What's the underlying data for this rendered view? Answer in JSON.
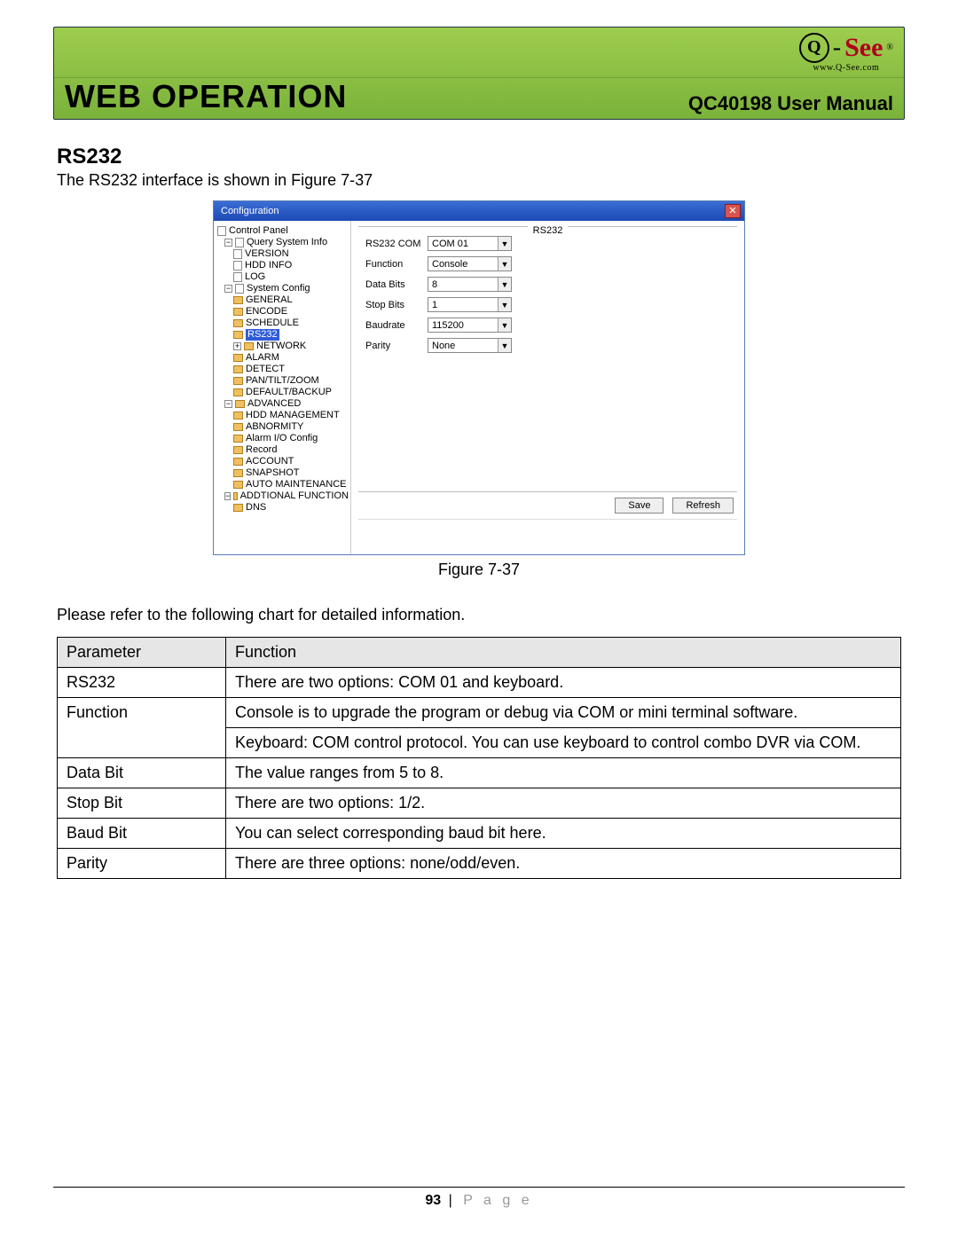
{
  "header": {
    "web_op": "WEB OPERATION",
    "manual": "QC40198 User Manual",
    "logo_text": "See",
    "logo_url": "www.Q-See.com"
  },
  "section": {
    "title": "RS232",
    "lead": "The RS232 interface is shown in Figure 7-37"
  },
  "window": {
    "title": "Configuration",
    "fieldset": "RS232",
    "save": "Save",
    "refresh": "Refresh",
    "form": {
      "com_label": "RS232 COM",
      "com_value": "COM 01",
      "func_label": "Function",
      "func_value": "Console",
      "data_label": "Data Bits",
      "data_value": "8",
      "stop_label": "Stop Bits",
      "stop_value": "1",
      "baud_label": "Baudrate",
      "baud_value": "115200",
      "parity_label": "Parity",
      "parity_value": "None"
    },
    "tree": {
      "root": "Control Panel",
      "g1": "Query System Info",
      "g1a": "VERSION",
      "g1b": "HDD INFO",
      "g1c": "LOG",
      "g2": "System Config",
      "g2a": "GENERAL",
      "g2b": "ENCODE",
      "g2c": "SCHEDULE",
      "g2d": "RS232",
      "g2e": "NETWORK",
      "g2f": "ALARM",
      "g2g": "DETECT",
      "g2h": "PAN/TILT/ZOOM",
      "g2i": "DEFAULT/BACKUP",
      "g3": "ADVANCED",
      "g3a": "HDD MANAGEMENT",
      "g3b": "ABNORMITY",
      "g3c": "Alarm I/O Config",
      "g3d": "Record",
      "g3e": "ACCOUNT",
      "g3f": "SNAPSHOT",
      "g3g": "AUTO MAINTENANCE",
      "g4": "ADDTIONAL FUNCTION",
      "g4a": "DNS"
    }
  },
  "figure_caption": "Figure 7-37",
  "param_intro": "Please refer to the following chart for detailed information.",
  "table": {
    "h1": "Parameter",
    "h2": "Function",
    "rows": [
      {
        "p": "RS232",
        "f": "There are two options: COM 01 and keyboard."
      },
      {
        "p": "Function",
        "f": "Console is to upgrade the program or debug via COM or mini terminal software.",
        "f2": "Keyboard: COM control protocol. You can use keyboard to control combo DVR via COM."
      },
      {
        "p": "Data Bit",
        "f": "The value ranges from 5 to 8."
      },
      {
        "p": "Stop Bit",
        "f": "There are two options: 1/2."
      },
      {
        "p": "Baud Bit",
        "f": "You can select corresponding baud bit here."
      },
      {
        "p": "Parity",
        "f": "There are three options: none/odd/even."
      }
    ]
  },
  "footer": {
    "page_no": "93",
    "page_word": "P a g e"
  }
}
